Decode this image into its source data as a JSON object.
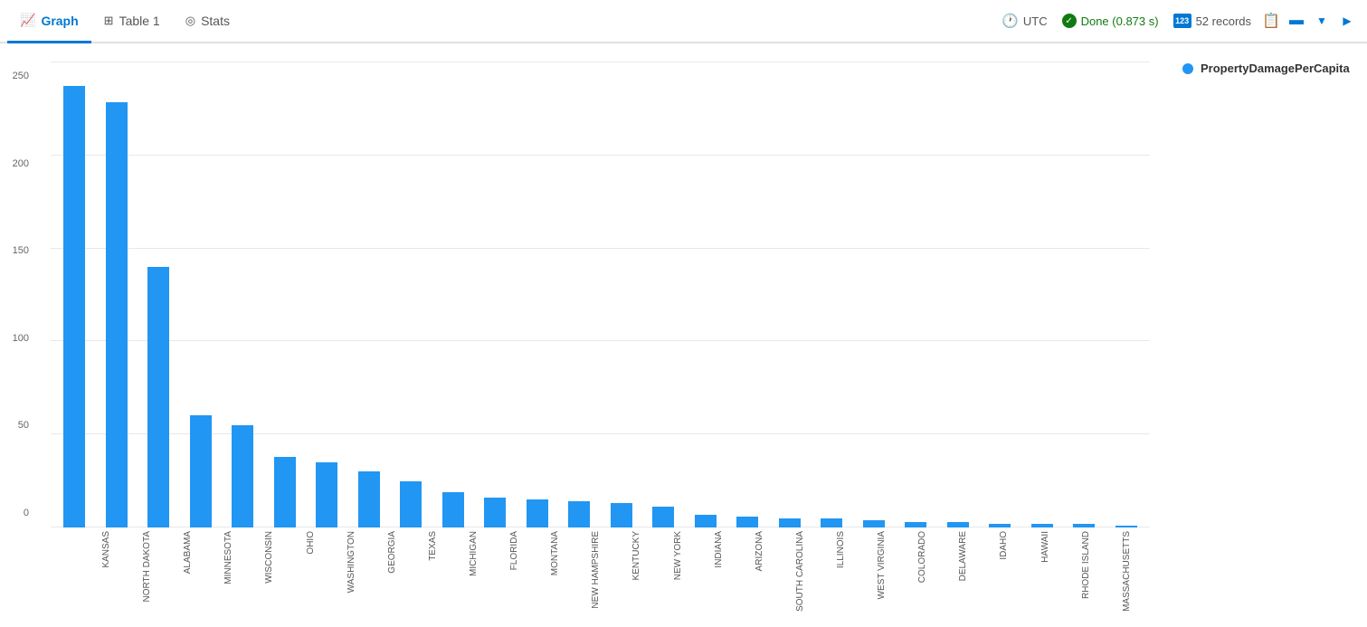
{
  "tabs": [
    {
      "id": "graph",
      "label": "Graph",
      "icon": "📈",
      "active": true
    },
    {
      "id": "table",
      "label": "Table 1",
      "icon": "⊞",
      "active": false
    },
    {
      "id": "stats",
      "label": "Stats",
      "icon": "◎",
      "active": false
    }
  ],
  "toolbar": {
    "utc_label": "UTC",
    "done_label": "Done (0.873 s)",
    "records_label": "52 records"
  },
  "legend": {
    "series_label": "PropertyDamagePerCapita"
  },
  "chart": {
    "y_labels": [
      "250",
      "200",
      "150",
      "100",
      "50",
      "0"
    ],
    "y_max": 250,
    "bars": [
      {
        "state": "KANSAS",
        "value": 237
      },
      {
        "state": "NORTH DAKOTA",
        "value": 228
      },
      {
        "state": "ALABAMA",
        "value": 140
      },
      {
        "state": "MINNESOTA",
        "value": 60
      },
      {
        "state": "WISCONSIN",
        "value": 55
      },
      {
        "state": "OHIO",
        "value": 38
      },
      {
        "state": "WASHINGTON",
        "value": 35
      },
      {
        "state": "GEORGIA",
        "value": 30
      },
      {
        "state": "TEXAS",
        "value": 25
      },
      {
        "state": "MICHIGAN",
        "value": 19
      },
      {
        "state": "FLORIDA",
        "value": 16
      },
      {
        "state": "MONTANA",
        "value": 15
      },
      {
        "state": "NEW HAMPSHIRE",
        "value": 14
      },
      {
        "state": "KENTUCKY",
        "value": 13
      },
      {
        "state": "NEW YORK",
        "value": 11
      },
      {
        "state": "INDIANA",
        "value": 7
      },
      {
        "state": "ARIZONA",
        "value": 6
      },
      {
        "state": "SOUTH CAROLINA",
        "value": 5
      },
      {
        "state": "ILLINOIS",
        "value": 5
      },
      {
        "state": "WEST VIRGINIA",
        "value": 4
      },
      {
        "state": "COLORADO",
        "value": 3
      },
      {
        "state": "DELAWARE",
        "value": 3
      },
      {
        "state": "IDAHO",
        "value": 2
      },
      {
        "state": "HAWAII",
        "value": 2
      },
      {
        "state": "RHODE ISLAND",
        "value": 2
      },
      {
        "state": "MASSACHUSETTS",
        "value": 1
      }
    ]
  }
}
